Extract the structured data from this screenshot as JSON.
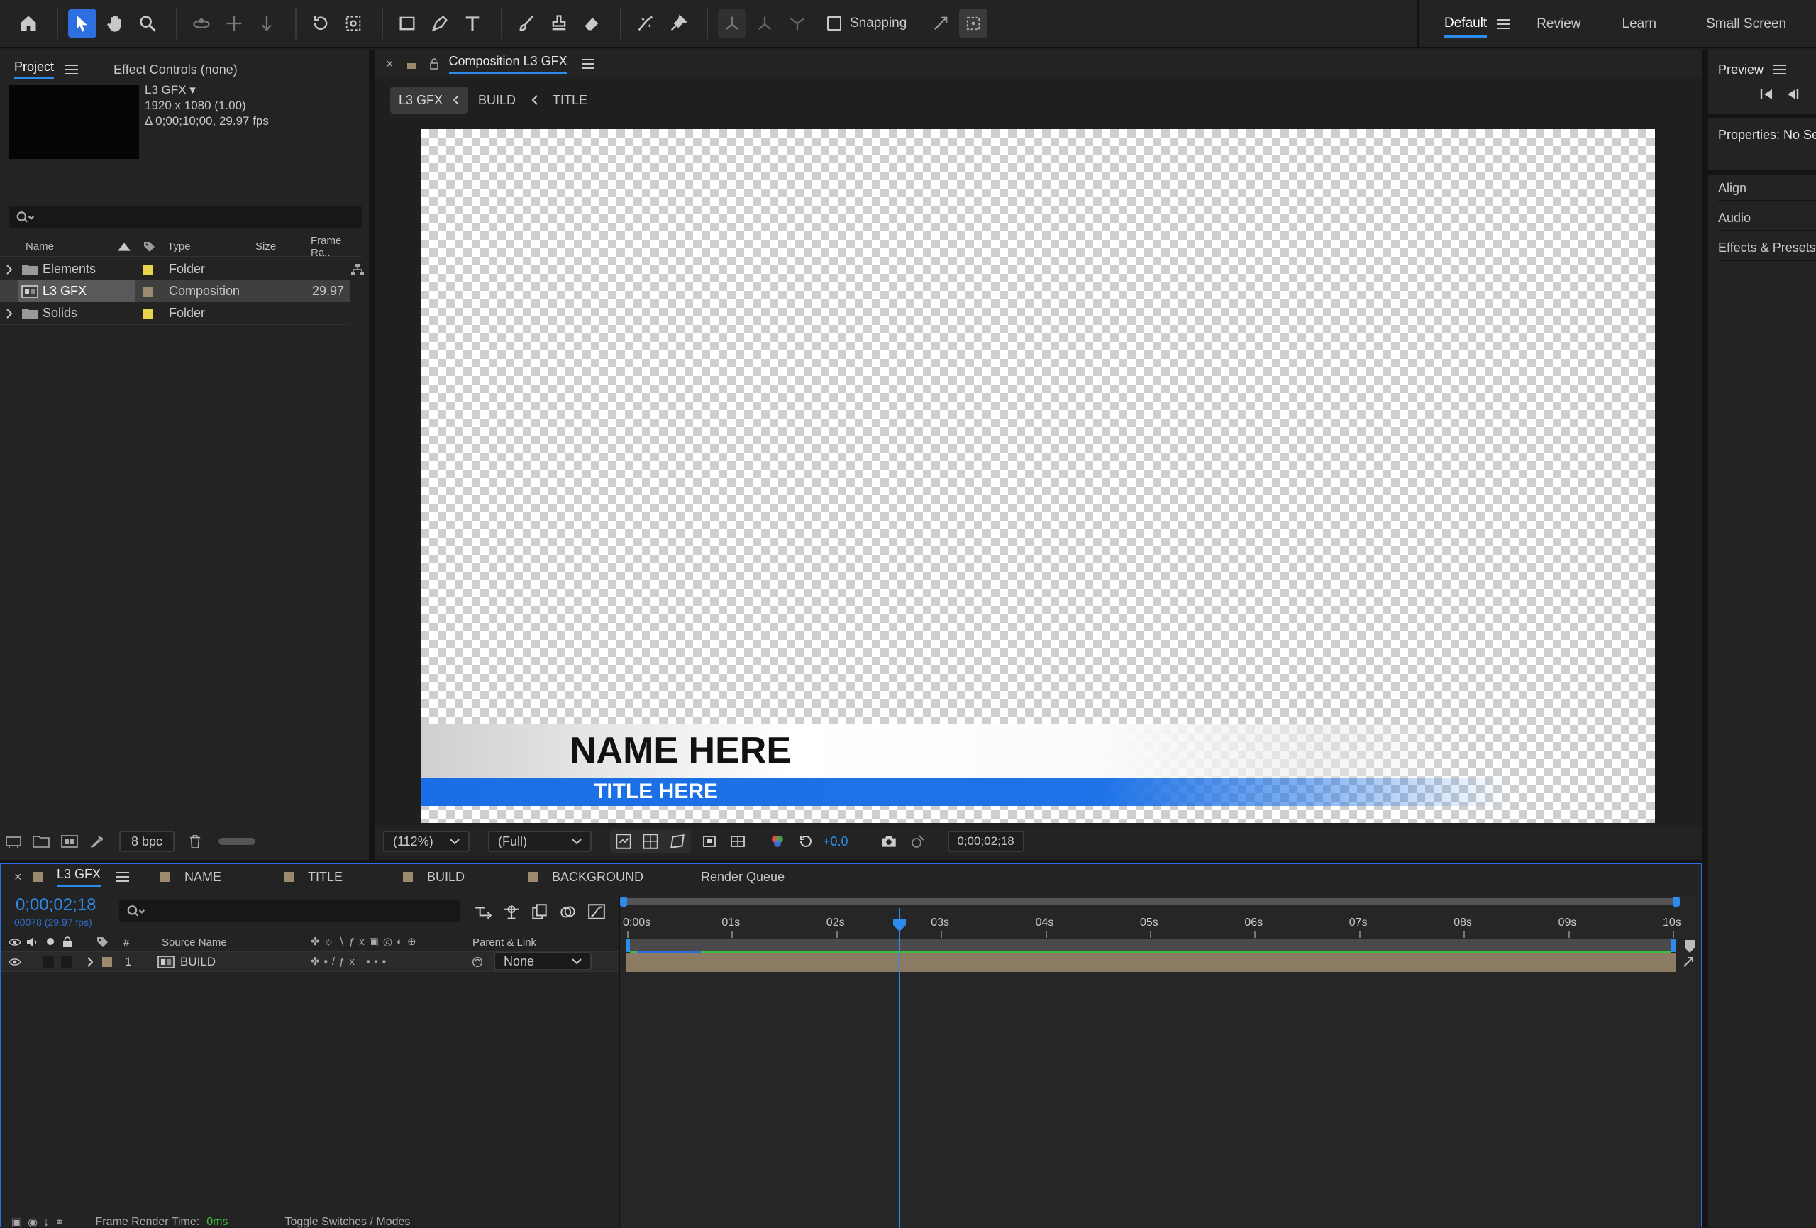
{
  "toolbar": {
    "snapping_label": "Snapping",
    "workspaces": [
      "Default",
      "Review",
      "Learn",
      "Small Screen"
    ],
    "active_workspace": "Default"
  },
  "project_panel": {
    "tab_project": "Project",
    "tab_effect_controls": "Effect Controls (none)",
    "comp_name": "L3 GFX ▾",
    "comp_dims": "1920 x 1080 (1.00)",
    "comp_duration": "Δ 0;00;10;00, 29.97 fps",
    "search_placeholder": "",
    "columns": {
      "name": "Name",
      "type": "Type",
      "size": "Size",
      "frame_rate": "Frame Ra.."
    },
    "items": [
      {
        "name": "Elements",
        "type": "Folder",
        "frame_rate": "",
        "color": "#e8d44c"
      },
      {
        "name": "L3 GFX",
        "type": "Composition",
        "frame_rate": "29.97",
        "color": "#9c8a6e"
      },
      {
        "name": "Solids",
        "type": "Folder",
        "frame_rate": "",
        "color": "#e8d44c"
      }
    ],
    "bpc": "8 bpc"
  },
  "composition_panel": {
    "title": "Composition L3 GFX",
    "breadcrumbs": [
      "L3 GFX",
      "BUILD",
      "TITLE"
    ],
    "lower_third": {
      "name_text": "NAME HERE",
      "title_text": "TITLE HERE",
      "accent_color": "#1e73e8"
    },
    "zoom": "(112%)",
    "resolution": "(Full)",
    "exposure": "+0.0",
    "timecode": "0;00;02;18"
  },
  "right_panel": {
    "preview": "Preview",
    "properties": "Properties: No Se",
    "items": [
      "Align",
      "Audio",
      "Effects & Presets"
    ]
  },
  "timeline": {
    "tabs": [
      {
        "label": "L3 GFX",
        "color": "#9c8a6e"
      },
      {
        "label": "NAME",
        "color": "#9c8a6e"
      },
      {
        "label": "TITLE",
        "color": "#9c8a6e"
      },
      {
        "label": "BUILD",
        "color": "#9c8a6e"
      },
      {
        "label": "BACKGROUND",
        "color": "#9c8a6e"
      },
      {
        "label": "Render Queue",
        "color": ""
      }
    ],
    "timecode": "0;00;02;18",
    "frames": "00078 (29.97 fps)",
    "headers": {
      "num": "#",
      "source_name": "Source Name",
      "parent": "Parent & Link"
    },
    "layer": {
      "num": "1",
      "name": "BUILD",
      "parent": "None"
    },
    "ruler_labels": [
      "0:00s",
      "01s",
      "02s",
      "03s",
      "04s",
      "05s",
      "06s",
      "07s",
      "08s",
      "09s",
      "10s"
    ],
    "playhead_seconds": 2.6,
    "duration_seconds": 10,
    "footer_render_time_label": "Frame Render Time:",
    "footer_render_time_value": "0ms",
    "footer_toggle": "Toggle Switches / Modes"
  }
}
